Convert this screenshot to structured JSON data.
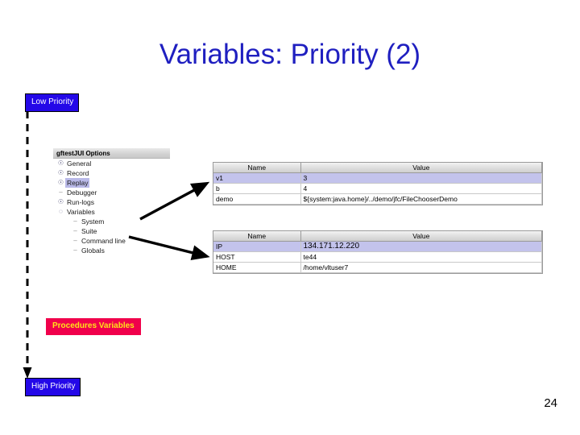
{
  "slide": {
    "title": "Variables: Priority (2)",
    "page_number": "24",
    "title_color": "#1f1fc0"
  },
  "priority_axis": {
    "low_label": "Low Priority",
    "high_label": "High Priority",
    "box_bg": "#2408e8",
    "box_text_color": "#ffffff",
    "line_style": "dashed-down-arrow"
  },
  "procedures_label": {
    "text": "Procedures Variables",
    "bg": "#f0004b",
    "text_color": "#ffe31a"
  },
  "options_panel": {
    "header": "gftestJUI Options",
    "tree": [
      {
        "label": "General",
        "level": 1,
        "icon": "key-icon",
        "selected": false
      },
      {
        "label": "Record",
        "level": 1,
        "icon": "key-icon",
        "selected": false
      },
      {
        "label": "Replay",
        "level": 1,
        "icon": "key-icon",
        "selected": true
      },
      {
        "label": "Debugger",
        "level": 1,
        "icon": "dash-icon",
        "selected": false
      },
      {
        "label": "Run-logs",
        "level": 1,
        "icon": "key-icon",
        "selected": false
      },
      {
        "label": "Variables",
        "level": 1,
        "icon": "node-icon",
        "selected": false
      },
      {
        "label": "System",
        "level": 2,
        "icon": "dash-icon",
        "selected": false
      },
      {
        "label": "Suite",
        "level": 2,
        "icon": "dash-icon",
        "selected": false
      },
      {
        "label": "Command line",
        "level": 2,
        "icon": "dash-icon",
        "selected": false
      },
      {
        "label": "Globals",
        "level": 2,
        "icon": "dash-icon",
        "selected": false
      }
    ]
  },
  "suite_table": {
    "columns": [
      "Name",
      "Value"
    ],
    "rows": [
      {
        "name": "v1",
        "value": "3",
        "selected": true
      },
      {
        "name": "b",
        "value": "4",
        "selected": false
      },
      {
        "name": "demo",
        "value": "${system:java.home}/../demo/jfc/FileChooserDemo",
        "selected": false
      }
    ]
  },
  "commandline_table": {
    "columns": [
      "Name",
      "Value"
    ],
    "rows": [
      {
        "name": "IP",
        "value": "134.171.12.220",
        "selected": true
      },
      {
        "name": "HOST",
        "value": "te44",
        "selected": false
      },
      {
        "name": "HOME",
        "value": "/home/vltuser7",
        "selected": false
      }
    ]
  }
}
